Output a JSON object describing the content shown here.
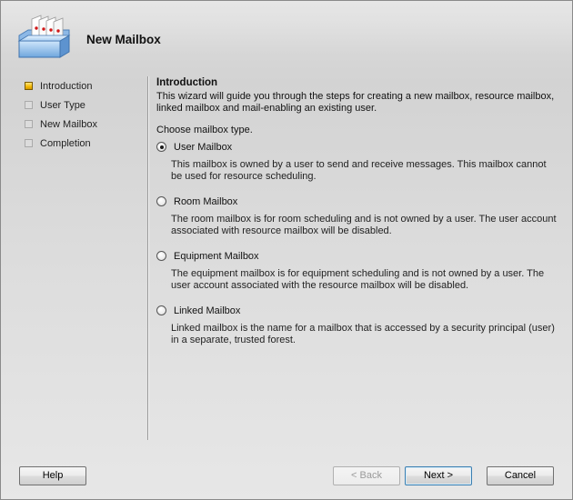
{
  "header": {
    "title": "New Mailbox",
    "icon": "mailbox-icon"
  },
  "nav": {
    "items": [
      {
        "label": "Introduction",
        "active": true
      },
      {
        "label": "User Type",
        "active": false
      },
      {
        "label": "New Mailbox",
        "active": false
      },
      {
        "label": "Completion",
        "active": false
      }
    ]
  },
  "content": {
    "title": "Introduction",
    "intro": "This wizard will guide you through the steps for creating a new mailbox, resource mailbox, linked mailbox and mail-enabling an existing user.",
    "choose_label": "Choose mailbox type.",
    "options": [
      {
        "label": "User Mailbox",
        "checked": true,
        "description": "This mailbox is owned by a user to send and receive messages. This mailbox cannot be used for resource scheduling."
      },
      {
        "label": "Room Mailbox",
        "checked": false,
        "description": "The room mailbox is for room scheduling and is not owned by a user. The user account associated with resource mailbox will be disabled."
      },
      {
        "label": "Equipment Mailbox",
        "checked": false,
        "description": "The equipment mailbox is for equipment scheduling and is not owned by a user. The user account associated with the resource mailbox will be disabled."
      },
      {
        "label": "Linked Mailbox",
        "checked": false,
        "description": "Linked mailbox is the name for a mailbox that is accessed by a security principal (user) in a separate, trusted forest."
      }
    ]
  },
  "buttons": {
    "help": "Help",
    "back": "< Back",
    "next": "Next >",
    "cancel": "Cancel"
  },
  "colors": {
    "active_step": "#f5b800",
    "default_button_border": "#3c7fb1"
  }
}
